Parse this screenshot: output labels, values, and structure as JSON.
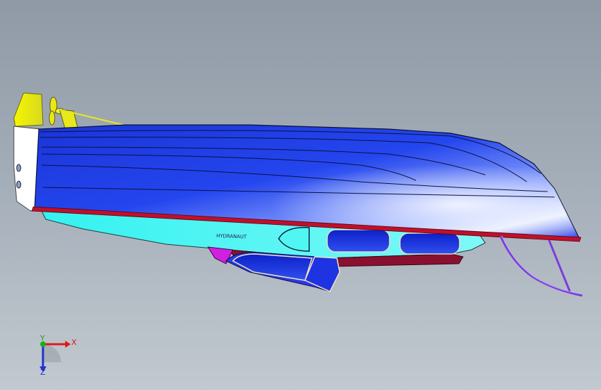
{
  "viewport": {
    "background_top": "#8f9aa6",
    "background_bottom": "#c2c9d0"
  },
  "model": {
    "hull_color": "#1f3fe6",
    "hull_highlight": "#d8e4ff",
    "underside_color": "#2ff5f0",
    "window_color": "#1830e0",
    "trim_color": "#c0102a",
    "keel_color": "#8a1030",
    "propeller_color": "#ecec10",
    "rail_color": "#7c3cd8",
    "transom_color": "#ffffff",
    "hull_lettering": "HYDRANAUT"
  },
  "triad": {
    "x_label": "X",
    "y_label": "Y",
    "z_label": "Z",
    "x_color": "#e01818",
    "y_color": "#18b018",
    "z_color": "#2030d0"
  }
}
